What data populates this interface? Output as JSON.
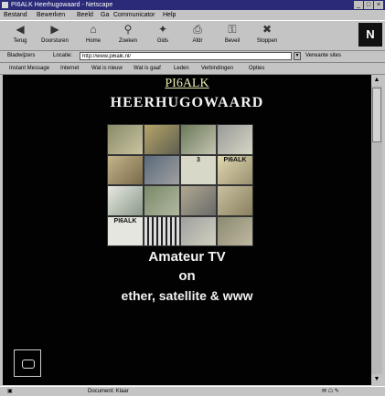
{
  "window": {
    "title": "PI6ALK Heerhugowaard - Netscape"
  },
  "menu": [
    "Bestand",
    "Bewerken",
    "Beeld",
    "Ga",
    "Communicator",
    "Help"
  ],
  "toolbar": [
    {
      "label": "Terug",
      "icon": "back-arrow-icon",
      "glyph": "◀"
    },
    {
      "label": "Doorsturen",
      "icon": "forward-arrow-icon",
      "glyph": "▶"
    },
    {
      "label": "Home",
      "icon": "home-icon",
      "glyph": "⌂"
    },
    {
      "label": "Zoeken",
      "icon": "search-icon",
      "glyph": "⚲"
    },
    {
      "label": "Gids",
      "icon": "guide-icon",
      "glyph": "✦"
    },
    {
      "label": "Afdr",
      "icon": "print-icon",
      "glyph": "⎙"
    },
    {
      "label": "Beveil",
      "icon": "security-icon",
      "glyph": "⚿"
    },
    {
      "label": "Stoppen",
      "icon": "stop-icon",
      "glyph": "✖"
    }
  ],
  "logo": "N",
  "address": {
    "bookmarks_label": "Bladwijzers",
    "location_label": "Locatie:",
    "url": "http://www.pi6alk.nl/",
    "related_label": "Verwante sites"
  },
  "links": [
    "Instant Message",
    "Internet",
    "Wat is nieuw",
    "Wat is gaaf",
    "Leden",
    "Verbindingen",
    "Opties"
  ],
  "page": {
    "callsign": "PI6ALK",
    "town": "HEERHUGOWAARD",
    "tagline": [
      "Amateur TV",
      "on",
      "ether, satellite & www"
    ],
    "mosaic_tiles": [
      "",
      "",
      "",
      "",
      "",
      "",
      "3",
      "PI6ALK",
      "",
      "",
      "",
      "",
      "PI6ALK",
      "",
      "",
      ""
    ]
  },
  "status": {
    "text": "Document: Klaar"
  },
  "colors": {
    "background": "#020202",
    "callsign": "#e8e8b0",
    "text": "#f2f2f2"
  }
}
